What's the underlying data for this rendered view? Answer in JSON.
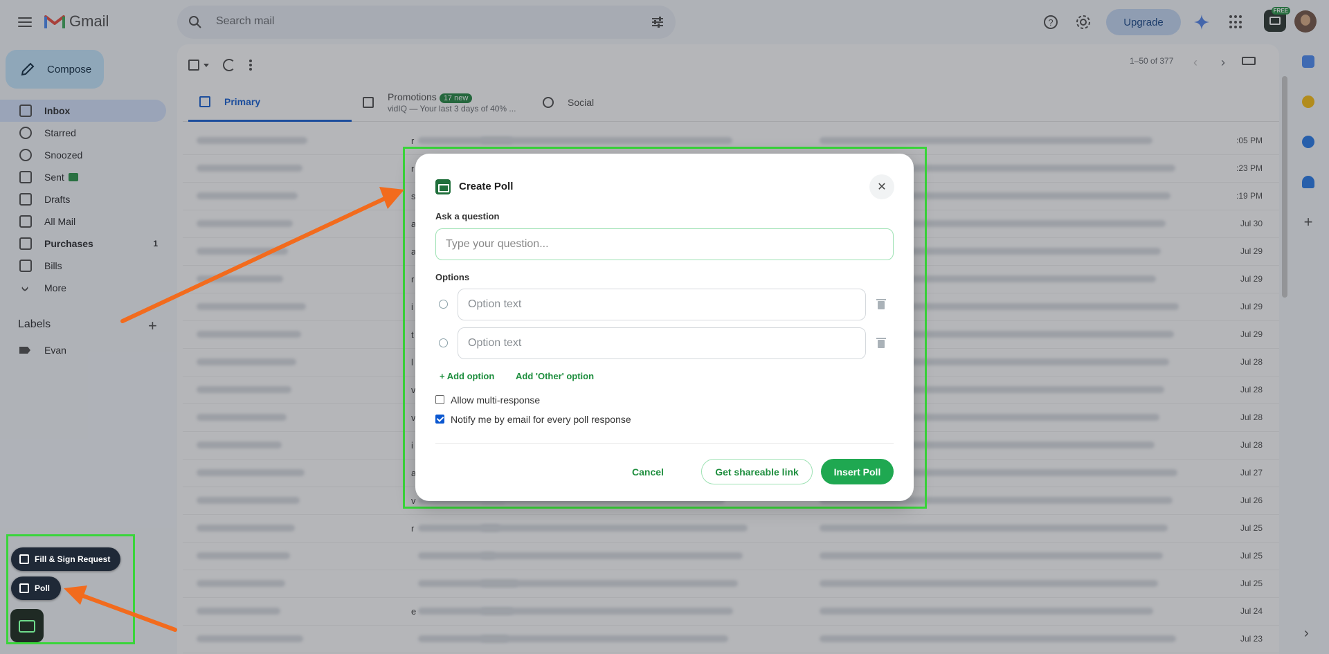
{
  "header": {
    "app_name": "Gmail",
    "search_placeholder": "Search mail",
    "upgrade_label": "Upgrade",
    "ext_badge": "FREE"
  },
  "sidebar": {
    "compose_label": "Compose",
    "items": [
      {
        "label": "Inbox",
        "count": "",
        "icon": "inbox-icon"
      },
      {
        "label": "Starred",
        "count": "",
        "icon": "star-icon"
      },
      {
        "label": "Snoozed",
        "count": "",
        "icon": "clock-icon"
      },
      {
        "label": "Sent",
        "count": "",
        "icon": "send-icon"
      },
      {
        "label": "Drafts",
        "count": "",
        "icon": "file-icon"
      },
      {
        "label": "All Mail",
        "count": "",
        "icon": "mail-icon"
      },
      {
        "label": "Purchases",
        "count": "1",
        "icon": "bag-icon"
      },
      {
        "label": "Bills",
        "count": "",
        "icon": "receipt-icon"
      },
      {
        "label": "More",
        "count": "",
        "icon": "chevron-down-icon"
      }
    ],
    "labels_heading": "Labels",
    "labels": [
      {
        "label": "Evan"
      }
    ]
  },
  "floating": {
    "fill_sign_label": "Fill & Sign Request",
    "poll_label": "Poll"
  },
  "toolbar": {
    "pager": "1–50 of 377"
  },
  "tabs": {
    "primary": "Primary",
    "promotions": "Promotions",
    "promotions_badge": "17 new",
    "promotions_sub": "vidIQ — Your last 3 days of 40% ...",
    "social": "Social"
  },
  "rows": [
    {
      "letter": "r",
      "date": ":05 PM"
    },
    {
      "letter": "r",
      "date": ":23 PM"
    },
    {
      "letter": "s",
      "date": ":19 PM"
    },
    {
      "letter": "a",
      "date": "Jul 30"
    },
    {
      "letter": "a",
      "date": "Jul 29"
    },
    {
      "letter": "r",
      "date": "Jul 29"
    },
    {
      "letter": "i",
      "date": "Jul 29"
    },
    {
      "letter": "t",
      "date": "Jul 29"
    },
    {
      "letter": "l",
      "date": "Jul 28"
    },
    {
      "letter": "v",
      "date": "Jul 28"
    },
    {
      "letter": "v",
      "date": "Jul 28"
    },
    {
      "letter": "i",
      "date": "Jul 28"
    },
    {
      "letter": "a",
      "date": "Jul 27"
    },
    {
      "letter": "v",
      "date": "Jul 26"
    },
    {
      "letter": "r",
      "date": "Jul 25"
    },
    {
      "letter": "",
      "date": "Jul 25"
    },
    {
      "letter": "",
      "date": "Jul 25"
    },
    {
      "letter": "e",
      "date": "Jul 24"
    },
    {
      "letter": "",
      "date": "Jul 23"
    }
  ],
  "modal": {
    "title": "Create Poll",
    "question_label": "Ask a question",
    "question_placeholder": "Type your question...",
    "options_label": "Options",
    "option_placeholder": "Option text",
    "add_option": "+ Add option",
    "add_other": "Add 'Other' option",
    "allow_multi": "Allow multi-response",
    "allow_multi_checked": false,
    "notify": "Notify me by email for every poll response",
    "notify_checked": true,
    "cancel": "Cancel",
    "share": "Get shareable link",
    "insert": "Insert Poll"
  },
  "colors": {
    "accent_green": "#1fa851",
    "highlight_frame": "#39d53a",
    "arrow": "#f26b1d"
  }
}
